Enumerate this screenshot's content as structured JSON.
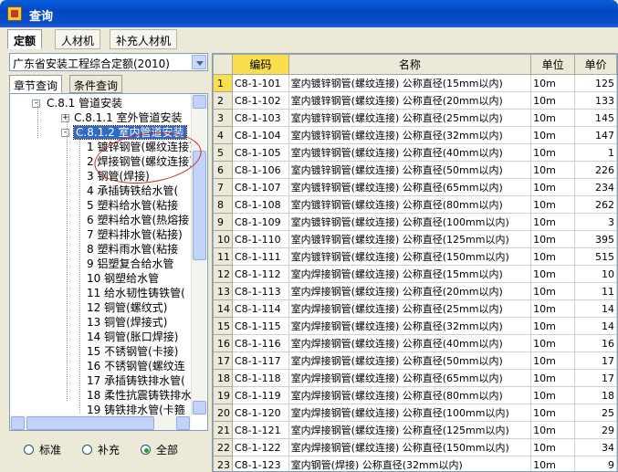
{
  "window": {
    "title": "查询"
  },
  "top_tabs": [
    {
      "label": "定额",
      "active": true
    },
    {
      "label": "人材机",
      "active": false
    },
    {
      "label": "补充人材机",
      "active": false
    }
  ],
  "left": {
    "library_select": "广东省安装工程综合定额(2010)",
    "subtabs": [
      "章节查询",
      "条件查询"
    ],
    "tree": [
      {
        "label": "C.8.1 管道安装",
        "level": 1,
        "expander": "-"
      },
      {
        "label": "C.8.1.1 室外管道安装",
        "level": 2,
        "expander": "+"
      },
      {
        "label": "C.8.1.2 室内管道安装",
        "level": 2,
        "expander": "-",
        "selected": true
      },
      {
        "label": "1 镀锌钢管(螺纹连接)",
        "level": 3
      },
      {
        "label": "2 焊接钢管(螺纹连接)",
        "level": 3
      },
      {
        "label": "3 钢管(焊接)",
        "level": 3
      },
      {
        "label": "4 承插铸铁给水管(",
        "level": 3
      },
      {
        "label": "5 塑料给水管(粘接",
        "level": 3
      },
      {
        "label": "6 塑料给水管(热熔接",
        "level": 3
      },
      {
        "label": "7 塑料排水管(粘接)",
        "level": 3
      },
      {
        "label": "8 塑料雨水管(粘接",
        "level": 3
      },
      {
        "label": "9 铝塑复合给水管",
        "level": 3
      },
      {
        "label": "10 钢塑给水管",
        "level": 3
      },
      {
        "label": "11 给水韧性铸铁管(",
        "level": 3
      },
      {
        "label": "12 铜管(螺纹式)",
        "level": 3
      },
      {
        "label": "13 铜管(焊接式)",
        "level": 3
      },
      {
        "label": "14 铜管(胀口焊接)",
        "level": 3
      },
      {
        "label": "15 不锈钢管(卡接)",
        "level": 3
      },
      {
        "label": "16 不锈钢管(螺纹连",
        "level": 3
      },
      {
        "label": "17 承插铸铁排水管(",
        "level": 3
      },
      {
        "label": "18 柔性抗震铸铁排水",
        "level": 3
      },
      {
        "label": "19 铸铁排水管(卡箍",
        "level": 3
      }
    ],
    "filters": [
      {
        "label": "标准",
        "checked": false
      },
      {
        "label": "补充",
        "checked": false
      },
      {
        "label": "全部",
        "checked": true
      }
    ]
  },
  "grid": {
    "columns": [
      "",
      "编码",
      "名称",
      "单位",
      "单价"
    ],
    "rows": [
      [
        "1",
        "C8-1-101",
        "室内镀锌钢管(螺纹连接) 公称直径(15mm以内)",
        "10m",
        "125"
      ],
      [
        "2",
        "C8-1-102",
        "室内镀锌钢管(螺纹连接) 公称直径(20mm以内)",
        "10m",
        "133"
      ],
      [
        "3",
        "C8-1-103",
        "室内镀锌钢管(螺纹连接) 公称直径(25mm以内)",
        "10m",
        "145"
      ],
      [
        "4",
        "C8-1-104",
        "室内镀锌钢管(螺纹连接) 公称直径(32mm以内)",
        "10m",
        "147"
      ],
      [
        "5",
        "C8-1-105",
        "室内镀锌钢管(螺纹连接) 公称直径(40mm以内)",
        "10m",
        "1"
      ],
      [
        "6",
        "C8-1-106",
        "室内镀锌钢管(螺纹连接) 公称直径(50mm以内)",
        "10m",
        "226"
      ],
      [
        "7",
        "C8-1-107",
        "室内镀锌钢管(螺纹连接) 公称直径(65mm以内)",
        "10m",
        "234"
      ],
      [
        "8",
        "C8-1-108",
        "室内镀锌钢管(螺纹连接) 公称直径(80mm以内)",
        "10m",
        "262"
      ],
      [
        "9",
        "C8-1-109",
        "室内镀锌钢管(螺纹连接) 公称直径(100mm以内)",
        "10m",
        "3"
      ],
      [
        "10",
        "C8-1-110",
        "室内镀锌钢管(螺纹连接) 公称直径(125mm以内)",
        "10m",
        "395"
      ],
      [
        "11",
        "C8-1-111",
        "室内镀锌钢管(螺纹连接) 公称直径(150mm以内)",
        "10m",
        "515"
      ],
      [
        "12",
        "C8-1-112",
        "室内焊接钢管(螺纹连接) 公称直径(15mm以内)",
        "10m",
        "10"
      ],
      [
        "13",
        "C8-1-113",
        "室内焊接钢管(螺纹连接) 公称直径(20mm以内)",
        "10m",
        "11"
      ],
      [
        "14",
        "C8-1-114",
        "室内焊接钢管(螺纹连接) 公称直径(25mm以内)",
        "10m",
        "14"
      ],
      [
        "15",
        "C8-1-115",
        "室内焊接钢管(螺纹连接) 公称直径(32mm以内)",
        "10m",
        "14"
      ],
      [
        "16",
        "C8-1-116",
        "室内焊接钢管(螺纹连接) 公称直径(40mm以内)",
        "10m",
        "16"
      ],
      [
        "17",
        "C8-1-117",
        "室内焊接钢管(螺纹连接) 公称直径(50mm以内)",
        "10m",
        "17"
      ],
      [
        "18",
        "C8-1-118",
        "室内焊接钢管(螺纹连接) 公称直径(65mm以内)",
        "10m",
        "17"
      ],
      [
        "19",
        "C8-1-119",
        "室内焊接钢管(螺纹连接) 公称直径(80mm以内)",
        "10m",
        "18"
      ],
      [
        "20",
        "C8-1-120",
        "室内焊接钢管(螺纹连接) 公称直径(100mm以内)",
        "10m",
        "25"
      ],
      [
        "21",
        "C8-1-121",
        "室内焊接钢管(螺纹连接) 公称直径(125mm以内)",
        "10m",
        "29"
      ],
      [
        "22",
        "C8-1-122",
        "室内焊接钢管(螺纹连接) 公称直径(150mm以内)",
        "10m",
        "34"
      ],
      [
        "23",
        "C8-1-123",
        "室内钢管(焊接) 公称直径(32mm以内)",
        "10m",
        "9"
      ]
    ]
  },
  "colors": {
    "title_blue": "#0348c2",
    "highlight": "#f9df4d",
    "selection": "#316ac5",
    "annotation_red": "#c72a2a"
  }
}
